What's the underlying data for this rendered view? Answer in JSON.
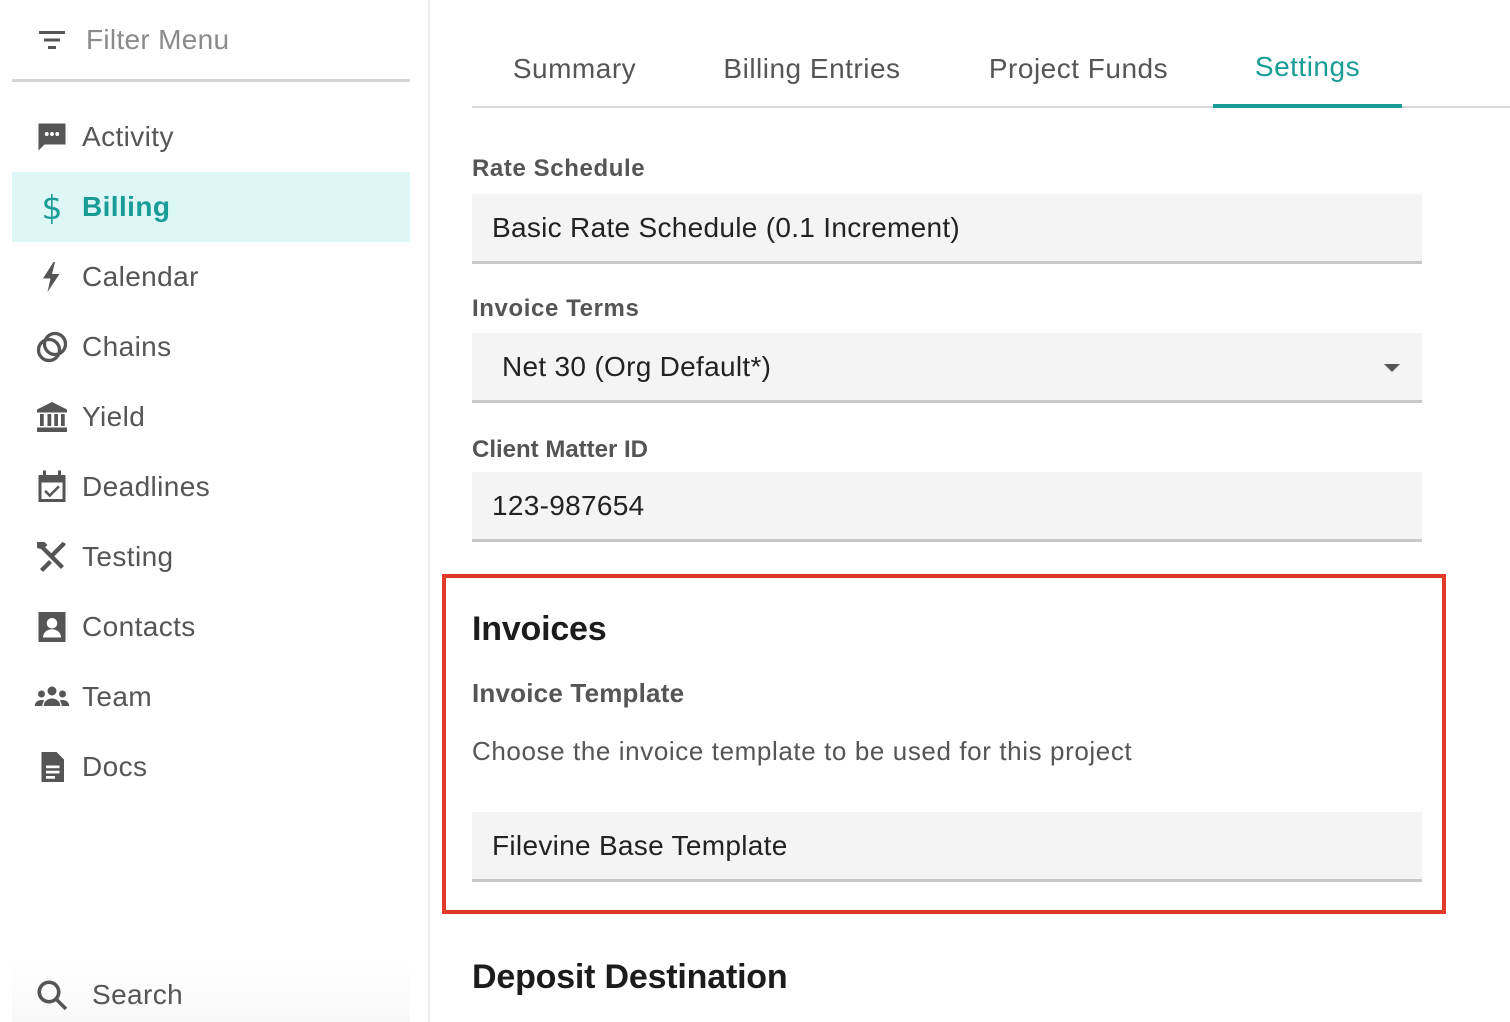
{
  "sidebar": {
    "filter_label": "Filter Menu",
    "items": [
      {
        "label": "Activity",
        "icon": "chat-icon"
      },
      {
        "label": "Billing",
        "icon": "dollar-icon",
        "active": true
      },
      {
        "label": "Calendar",
        "icon": "lightning-icon"
      },
      {
        "label": "Chains",
        "icon": "rings-icon"
      },
      {
        "label": "Yield",
        "icon": "bank-icon"
      },
      {
        "label": "Deadlines",
        "icon": "calendar-check-icon"
      },
      {
        "label": "Testing",
        "icon": "tools-icon"
      },
      {
        "label": "Contacts",
        "icon": "contact-card-icon"
      },
      {
        "label": "Team",
        "icon": "group-icon"
      },
      {
        "label": "Docs",
        "icon": "document-icon"
      }
    ],
    "search_label": "Search"
  },
  "tabs": [
    {
      "label": "Summary"
    },
    {
      "label": "Billing Entries"
    },
    {
      "label": "Project Funds"
    },
    {
      "label": "Settings",
      "active": true
    }
  ],
  "settings": {
    "rate_schedule": {
      "label": "Rate Schedule",
      "value": "Basic Rate Schedule (0.1 Increment)"
    },
    "invoice_terms": {
      "label": "Invoice Terms",
      "value": "Net 30 (Org Default*)"
    },
    "client_matter": {
      "label": "Client Matter ID",
      "value": "123-987654"
    }
  },
  "invoices": {
    "title": "Invoices",
    "template_label": "Invoice Template",
    "template_hint": "Choose the invoice template to be used for this project",
    "template_value": "Filevine Base Template"
  },
  "deposit": {
    "title": "Deposit Destination"
  },
  "colors": {
    "accent": "#1a9c96",
    "active_bg": "#dcf7f6",
    "highlight": "#e13a2b"
  }
}
